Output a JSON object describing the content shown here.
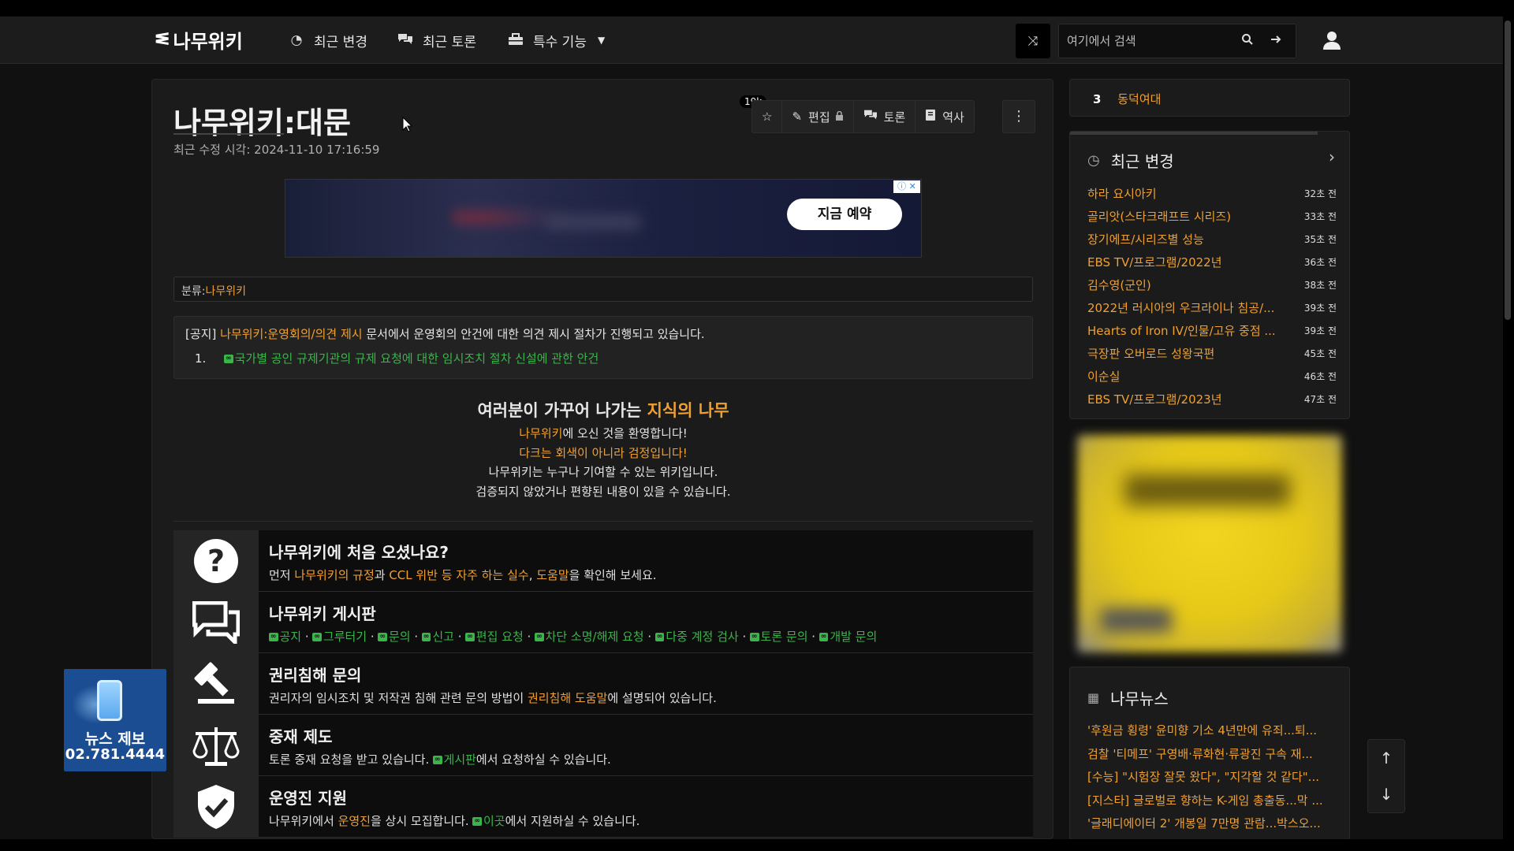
{
  "navbar": {
    "logo_text": "나무위키",
    "items": [
      {
        "icon": "compass-icon",
        "label": "최근 변경"
      },
      {
        "icon": "comments-icon",
        "label": "최근 토론"
      },
      {
        "icon": "toolbox-icon",
        "label": "특수 기능"
      }
    ],
    "search_placeholder": "여기에서 검색"
  },
  "article": {
    "title": "나무위키:대문",
    "modified": "최근 수정 시각: 2024-11-10 17:16:59",
    "star_count": "19k",
    "toolbar": [
      {
        "icon": "pencil-icon",
        "label": "편집"
      },
      {
        "icon": "comments-icon",
        "label": "토론"
      },
      {
        "icon": "book-icon",
        "label": "역사"
      }
    ],
    "ad_button": "지금 예약",
    "category_prefix": "분류:",
    "category_link": "나무위키",
    "notice": {
      "tag": "[공지]",
      "link": "나무위키:운영회의/의견 제시",
      "text": " 문서에서 운영회의 안건에 대한 의견 제시 절차가 진행되고 있습니다.",
      "item_num": "1.",
      "item": "국가별 공인 규제기관의 규제 요청에 대한 임시조치 절차 신설에 관한 안건"
    },
    "welcome": {
      "head_pre": "여러분이 가꾸어 나가는 ",
      "head_accent": "지식의 나무",
      "l1_accent": "나무위키",
      "l1_rest": "에 오신 것을 환영합니다!",
      "l2": "다크는 회색이 아니라 검정입니다!",
      "l3": "나무위키는 누구나 기여할 수 있는 위키입니다.",
      "l4": "검증되지 않았거나 편향된 내용이 있을 수 있습니다."
    },
    "sections": {
      "first": {
        "title": "나무위키에 처음 오셨나요?",
        "p1": "먼저 ",
        "a1": "나무위키의 규정",
        "p2": "과 ",
        "a2": "CCL 위반 등 자주 하는 실수",
        "p3": ", ",
        "a3": "도움말",
        "p4": "을 확인해 보세요."
      },
      "board": {
        "title": "나무위키 게시판",
        "links": [
          "공지",
          "그루터기",
          "문의",
          "신고",
          "편집 요청",
          "차단 소명/해제 요청",
          "다중 계정 검사",
          "토론 문의",
          "개발 문의"
        ],
        "sep": " · "
      },
      "rights": {
        "title": "권리침해 문의",
        "p1": "권리자의 임시조치 및 저작권 침해 관련 문의 방법이 ",
        "a1": "권리침해 도움말",
        "p2": "에 설명되어 있습니다."
      },
      "arbitration": {
        "title": "중재 제도",
        "p1": "토론 중재 요청을 받고 있습니다. ",
        "a1": "게시판",
        "p2": "에서 요청하실 수 있습니다."
      },
      "staff": {
        "title": "운영진 지원",
        "p1": "나무위키에서 ",
        "a1": "운영진",
        "p2": "을 상시 모집합니다. ",
        "a2": "이곳",
        "p3": "에서 지원하실 수 있습니다."
      }
    }
  },
  "sidebar": {
    "trending": {
      "rank": "3",
      "label": "동덕여대"
    },
    "recent_changes": {
      "title": "최근 변경",
      "items": [
        {
          "title": "하라 요시아키",
          "time": "32초 전"
        },
        {
          "title": "골리앗(스타크래프트 시리즈)",
          "time": "33초 전"
        },
        {
          "title": "장기에프/시리즈별 성능",
          "time": "35초 전"
        },
        {
          "title": "EBS TV/프로그램/2022년",
          "time": "36초 전"
        },
        {
          "title": "김수영(군인)",
          "time": "38초 전"
        },
        {
          "title": "2022년 러시아의 우크라이나 침공/...",
          "time": "39초 전"
        },
        {
          "title": "Hearts of Iron IV/인물/고유 중점 ...",
          "time": "39초 전"
        },
        {
          "title": "극장판 오버로드 성왕국편",
          "time": "45초 전"
        },
        {
          "title": "이순실",
          "time": "46초 전"
        },
        {
          "title": "EBS TV/프로그램/2023년",
          "time": "47초 전"
        }
      ]
    },
    "news": {
      "title": "나무뉴스",
      "items": [
        "'후원금 횡령' 윤미향 기소 4년만에 유죄...퇴...",
        "검찰 '티메프' 구영배·류화현·류광진 구속 재...",
        "[수능] \"시험장 잘못 왔다\", \"지각할 것 같다\"...",
        "[지스타] 글로벌로 향하는 K-게임 총출동...막 ...",
        "'글래디에이터 2' 개봉일 7만명 관람...박스오..."
      ]
    }
  },
  "news_tip": {
    "line1": "뉴스 제보",
    "line2": "02.781.4444"
  },
  "colors": {
    "accent": "#f0a030",
    "link_green": "#39b54a",
    "background": "#111111",
    "panel": "#1b1b1b"
  }
}
